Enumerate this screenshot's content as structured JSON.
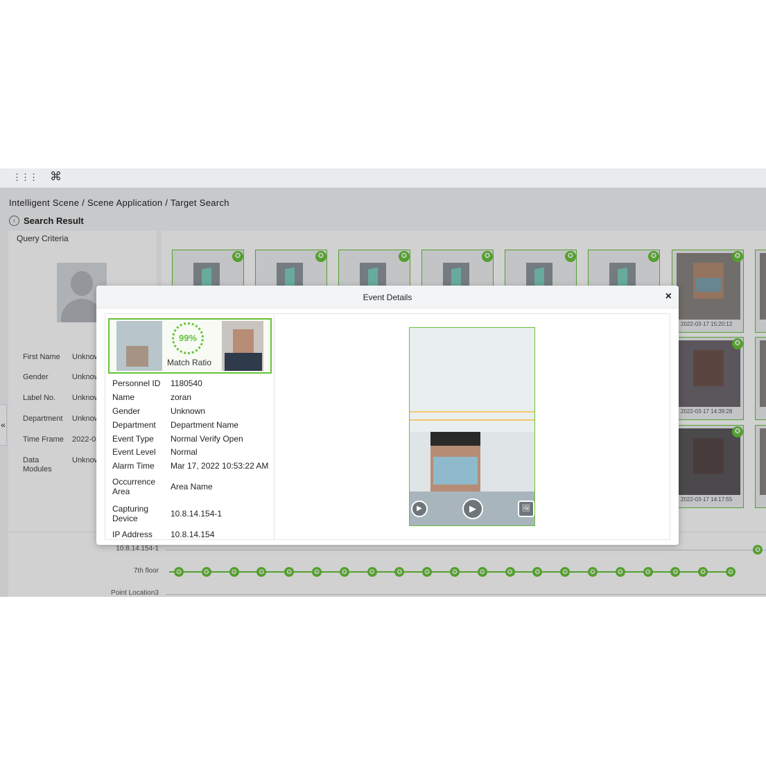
{
  "topbar": {
    "apps_icon": "⋮⋮⋮",
    "cmd_icon": "⌘"
  },
  "breadcrumb": "Intelligent Scene / Scene Application / Target Search",
  "search_result": {
    "title": "Search Result",
    "back_icon": "‹"
  },
  "query": {
    "title": "Query Criteria",
    "fields": [
      {
        "label": "First Name",
        "value": "Unknown"
      },
      {
        "label": "Gender",
        "value": "Unknown"
      },
      {
        "label": "Label No.",
        "value": "Unknown"
      },
      {
        "label": "Department",
        "value": "Unknown"
      },
      {
        "label": "Time Frame",
        "value": "2022-03-17"
      },
      {
        "label": "Data Modules",
        "value": "Unknown"
      }
    ]
  },
  "results": {
    "timestamps": [
      "2022-03-17 15:20:12",
      "2022-03-17 14:39:28",
      "2022-03-17 14:17:55"
    ]
  },
  "timeline": {
    "labels": [
      "10.8.14.154-1",
      "7th floor",
      "Point Location3"
    ]
  },
  "collapse_icon": "«",
  "modal": {
    "title": "Event Details",
    "close": "×",
    "match_ratio": "99%",
    "match_label": "Match Ratio",
    "fields": [
      {
        "label": "Personnel ID",
        "value": "1180540"
      },
      {
        "label": "Name",
        "value": "zoran"
      },
      {
        "label": "Gender",
        "value": "Unknown"
      },
      {
        "label": "Department",
        "value": "Department Name"
      },
      {
        "label": "Event Type",
        "value": "Normal Verify Open"
      },
      {
        "label": "Event Level",
        "value": "Normal"
      },
      {
        "label": "Alarm Time",
        "value": "Mar 17, 2022 10:53:22 AM"
      },
      {
        "label": "Occurrence Area",
        "value": "Area Name"
      },
      {
        "label": "Capturing Device",
        "value": "10.8.14.154-1"
      },
      {
        "label": "IP Address",
        "value": "10.8.14.154"
      }
    ],
    "controls": {
      "play_small": "▶",
      "play": "▶",
      "snapshot": "🖼"
    }
  },
  "colors": {
    "accent": "#67c23a"
  }
}
